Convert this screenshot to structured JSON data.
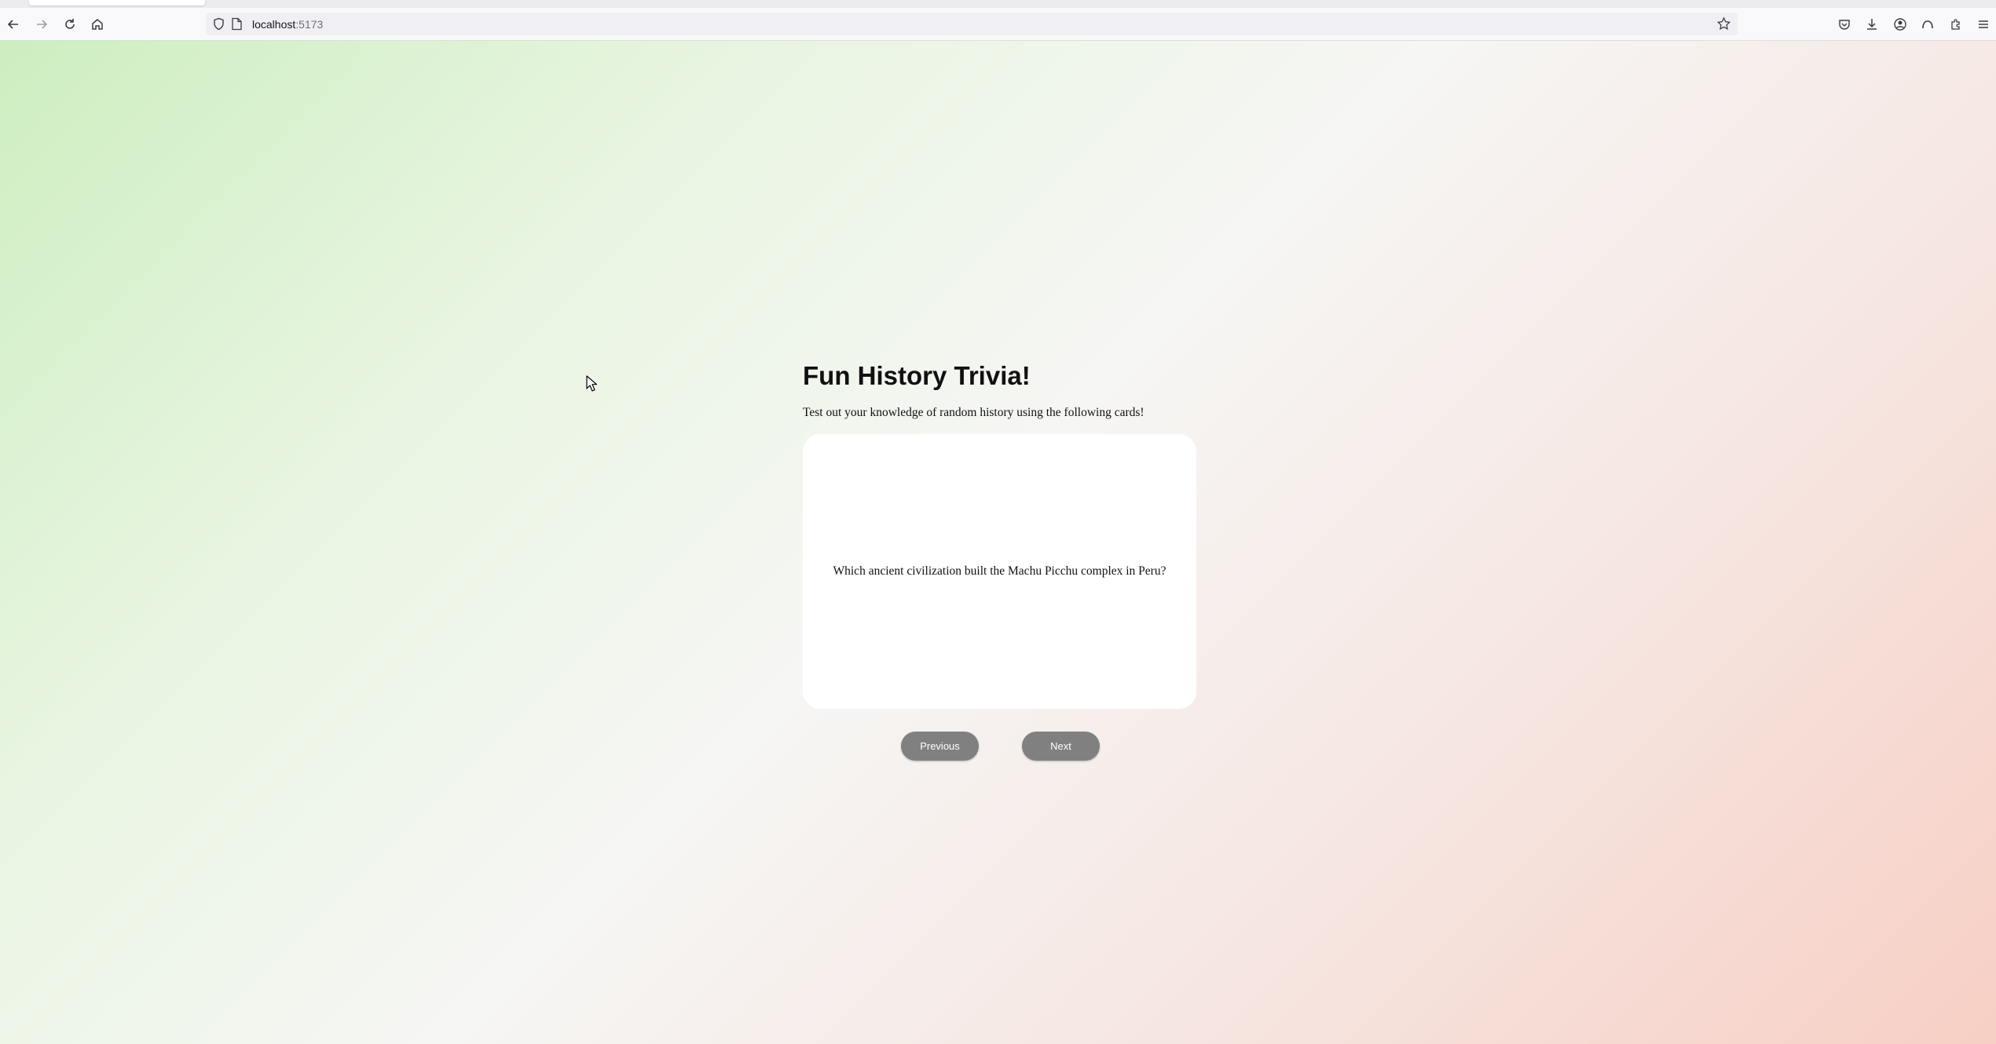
{
  "browser": {
    "url_host": "localhost",
    "url_port": ":5173",
    "icons": [
      "back-icon",
      "forward-icon",
      "reload-icon",
      "home-icon",
      "shield-icon",
      "page-icon",
      "bookmark-star-icon",
      "pocket-icon",
      "downloads-icon",
      "account-icon",
      "firefox-view-icon",
      "extensions-icon",
      "menu-icon"
    ]
  },
  "page": {
    "title": "Fun History Trivia!",
    "subtitle": "Test out your knowledge of random history using the following cards!",
    "card": {
      "question": "Which ancient civilization built the Machu Picchu complex in Peru?"
    },
    "buttons": {
      "previous": "Previous",
      "next": "Next"
    },
    "colors": {
      "button_bg": "#808080",
      "card_bg": "#ffffff",
      "gradient_start": "#cdeec0",
      "gradient_mid": "#f6f6f4",
      "gradient_end": "#f7cfc4"
    }
  }
}
